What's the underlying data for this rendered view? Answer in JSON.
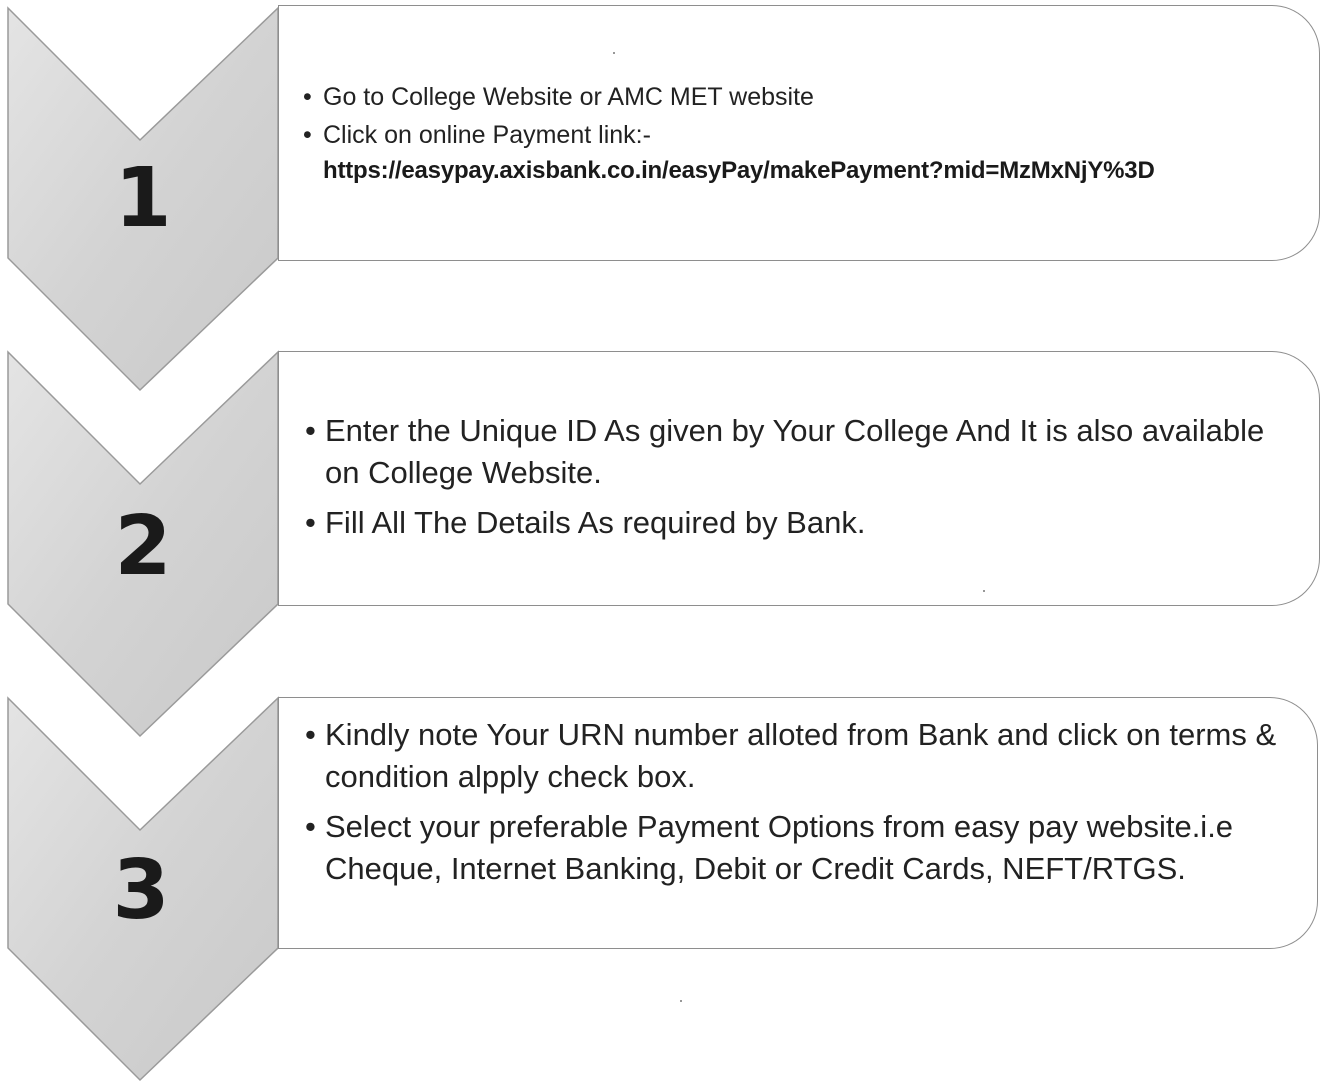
{
  "steps": [
    {
      "number": "1",
      "bullets": [
        "Go to College Website or AMC MET website",
        "Click on online Payment link:-"
      ],
      "link": "https://easypay.axisbank.co.in/easyPay/makePayment?mid=MzMxNjY%3D"
    },
    {
      "number": "2",
      "bullets": [
        "Enter the Unique ID As given by Your College And It is  also available on College Website.",
        "Fill All The Details As required by Bank."
      ]
    },
    {
      "number": "3",
      "bullets": [
        "Kindly note Your URN number alloted from Bank and  click on terms & condition alpply check box.",
        "Select your preferable Payment Options from easy pay website.i.e Cheque, Internet Banking, Debit or Credit Cards, NEFT/RTGS."
      ]
    }
  ],
  "colors": {
    "chevron_fill": "#d6d6d6",
    "chevron_stroke": "#9a9a9a",
    "box_border": "#8e8e8e",
    "text": "#222222"
  }
}
